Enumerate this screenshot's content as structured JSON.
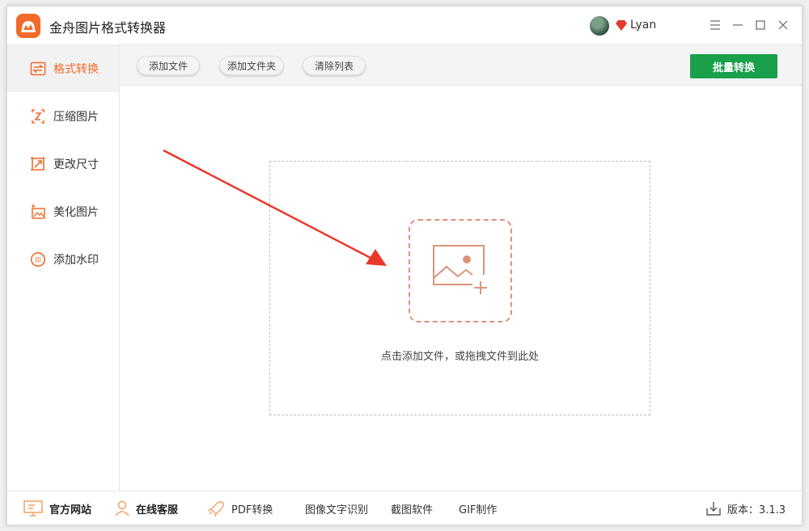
{
  "app": {
    "title": "金舟图片格式转换器",
    "user_name": "Lyan"
  },
  "sidebar": {
    "items": [
      {
        "label": "格式转换",
        "icon": "convert-icon",
        "active": true
      },
      {
        "label": "压缩图片",
        "icon": "compress-icon",
        "active": false
      },
      {
        "label": "更改尺寸",
        "icon": "resize-icon",
        "active": false
      },
      {
        "label": "美化图片",
        "icon": "beautify-icon",
        "active": false
      },
      {
        "label": "添加水印",
        "icon": "watermark-icon",
        "active": false
      }
    ]
  },
  "toolbar": {
    "add_file": "添加文件",
    "add_folder": "添加文件夹",
    "clear_list": "清除列表",
    "batch_convert": "批量转换"
  },
  "dropzone": {
    "hint": "点击添加文件，或拖拽文件到此处"
  },
  "footer": {
    "links": [
      {
        "label": "官方网站",
        "icon": "monitor-icon"
      },
      {
        "label": "在线客服",
        "icon": "person-icon"
      },
      {
        "label": "PDF转换",
        "icon": "rocket-icon"
      },
      {
        "label": "图像文字识别"
      },
      {
        "label": "截图软件"
      },
      {
        "label": "GIF制作"
      }
    ],
    "version": "版本：3.1.3"
  },
  "colors": {
    "accent": "#f26a2a",
    "primary_button": "#1aa04a",
    "arrow": "#e8392b"
  }
}
